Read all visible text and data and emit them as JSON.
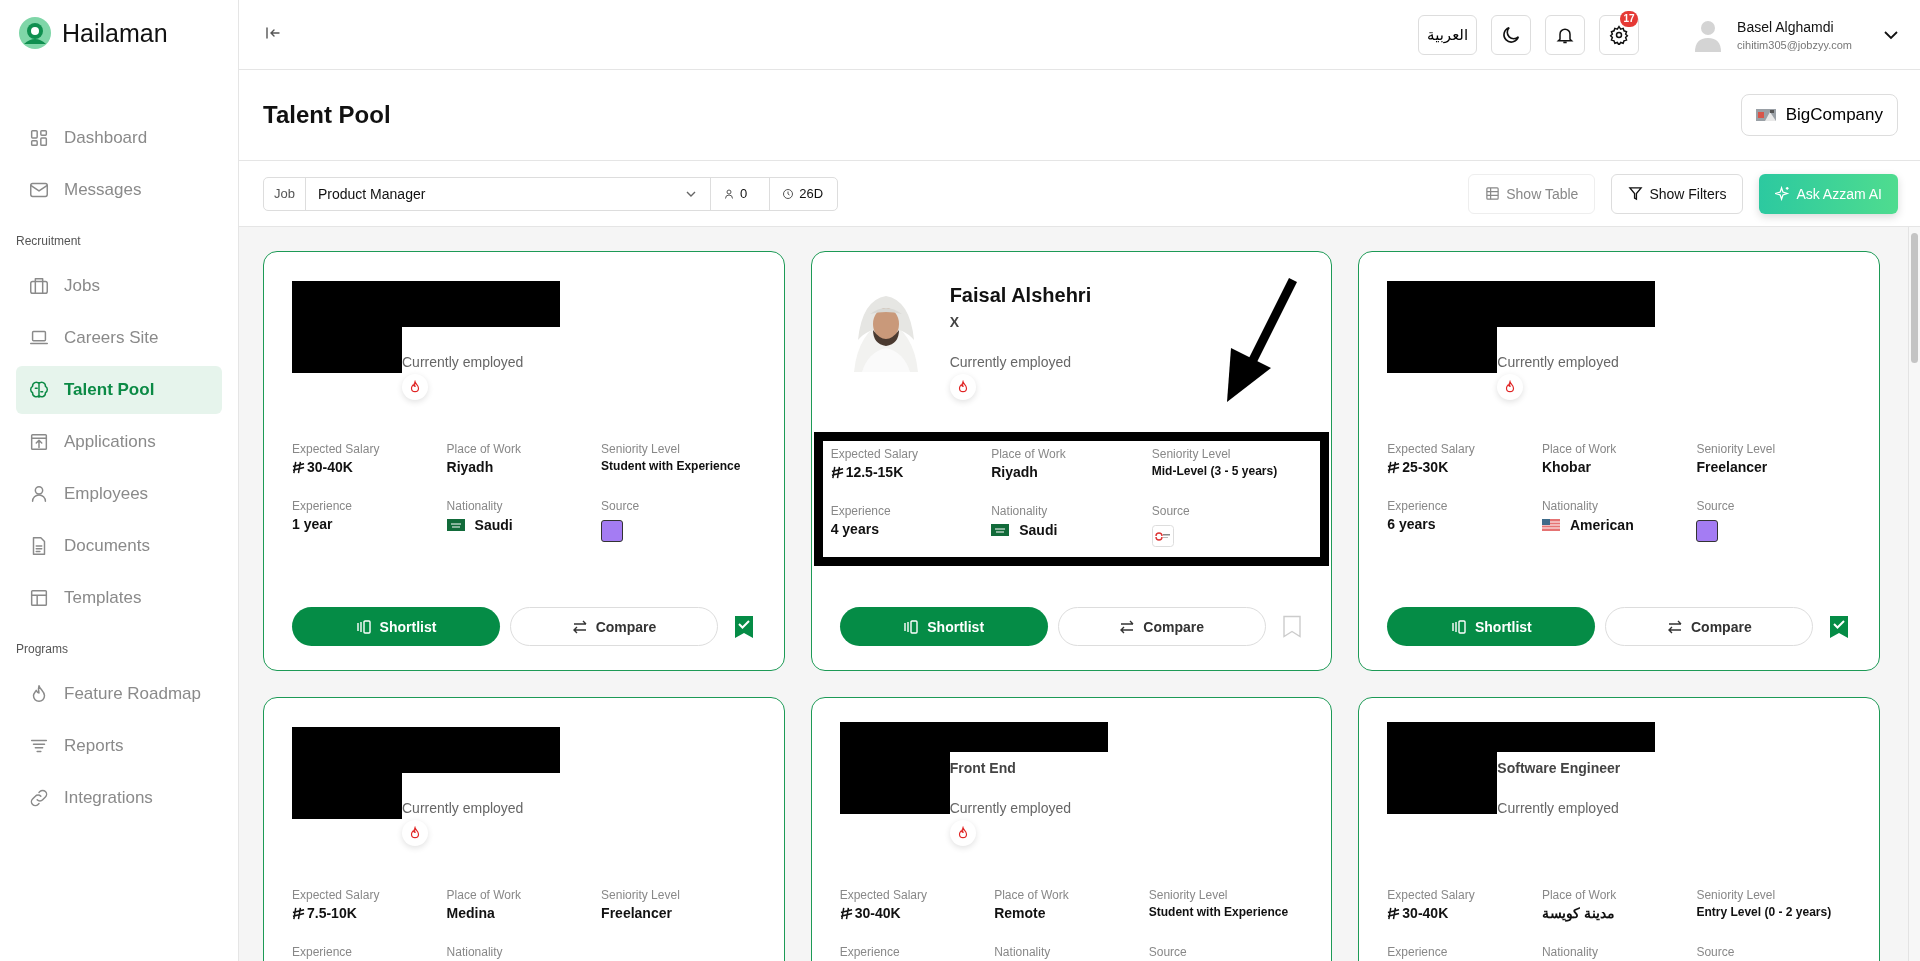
{
  "app": {
    "name": "Hailaman"
  },
  "sidebar": {
    "groups": [
      {
        "items": [
          {
            "label": "Dashboard",
            "selected": false
          },
          {
            "label": "Messages",
            "selected": false
          }
        ]
      },
      {
        "heading": "Recruitment",
        "items": [
          {
            "label": "Jobs",
            "selected": false
          },
          {
            "label": "Careers Site",
            "selected": false
          },
          {
            "label": "Talent Pool",
            "selected": true
          },
          {
            "label": "Applications",
            "selected": false
          },
          {
            "label": "Employees",
            "selected": false
          },
          {
            "label": "Documents",
            "selected": false
          },
          {
            "label": "Templates",
            "selected": false
          }
        ]
      },
      {
        "heading": "Programs",
        "items": [
          {
            "label": "Feature Roadmap",
            "selected": false
          },
          {
            "label": "Reports",
            "selected": false
          },
          {
            "label": "Integrations",
            "selected": false
          }
        ]
      }
    ]
  },
  "topbar": {
    "language": "العربية",
    "notifications": "17",
    "user": {
      "name": "Basel Alghamdi",
      "email": "cihitim305@jobzyy.com"
    }
  },
  "page": {
    "title": "Talent Pool",
    "company": "BigCompany"
  },
  "filter_bar": {
    "job_label": "Job",
    "job": "Product Manager",
    "applicants": "0",
    "age": "26D",
    "buttons": [
      {
        "label": "Show Table",
        "kind": "table",
        "disabled": true
      },
      {
        "label": "Show Filters",
        "kind": "filter",
        "disabled": false
      },
      {
        "label": "Ask Azzam AI",
        "kind": "ai",
        "disabled": false
      }
    ]
  },
  "cards": [
    {
      "redacted": true,
      "photo": false,
      "status": "Currently employed",
      "hot": true,
      "annotated": false,
      "bookmarked": true,
      "facts": [
        {
          "kind": "salary",
          "label": "Expected Salary",
          "value": "30-40K"
        },
        {
          "kind": "text",
          "label": "Place of Work",
          "value": "Riyadh"
        },
        {
          "kind": "small",
          "label": "Seniority Level",
          "value": "Student with Experience"
        },
        {
          "kind": "text",
          "label": "Experience",
          "value": "1 year"
        },
        {
          "kind": "greenflag",
          "label": "Nationality",
          "value": "Saudi"
        },
        {
          "kind": "source-square",
          "label": "Source"
        }
      ],
      "shortlist": "Shortlist",
      "compare": "Compare"
    },
    {
      "redacted": false,
      "photo": true,
      "name": "Faisal Alshehri",
      "subtitle": "X",
      "status": "Currently employed",
      "hot": true,
      "annotated": true,
      "bookmarked": false,
      "facts": [
        {
          "kind": "salary",
          "label": "Expected Salary",
          "value": "12.5-15K"
        },
        {
          "kind": "text",
          "label": "Place of Work",
          "value": "Riyadh"
        },
        {
          "kind": "small",
          "label": "Seniority Level",
          "value": "Mid-Level (3 - 5 years)"
        },
        {
          "kind": "text",
          "label": "Experience",
          "value": "4 years"
        },
        {
          "kind": "greenflag",
          "label": "Nationality",
          "value": "Saudi"
        },
        {
          "kind": "source-logo",
          "label": "Source"
        }
      ],
      "shortlist": "Shortlist",
      "compare": "Compare"
    },
    {
      "redacted": true,
      "photo": false,
      "status": "Currently employed",
      "hot": true,
      "annotated": false,
      "bookmarked": true,
      "facts": [
        {
          "kind": "salary",
          "label": "Expected Salary",
          "value": "25-30K"
        },
        {
          "kind": "text",
          "label": "Place of Work",
          "value": "Khobar"
        },
        {
          "kind": "text",
          "label": "Seniority Level",
          "value": "Freelancer"
        },
        {
          "kind": "text",
          "label": "Experience",
          "value": "6 years"
        },
        {
          "kind": "stripeflag",
          "label": "Nationality",
          "value": "American"
        },
        {
          "kind": "source-square",
          "label": "Source"
        }
      ],
      "shortlist": "Shortlist",
      "compare": "Compare"
    },
    {
      "redacted": true,
      "photo": false,
      "status": "Currently employed",
      "hot": true,
      "annotated": false,
      "facts": [
        {
          "kind": "salary",
          "label": "Expected Salary",
          "value": "7.5-10K"
        },
        {
          "kind": "text",
          "label": "Place of Work",
          "value": "Medina"
        },
        {
          "kind": "text",
          "label": "Seniority Level",
          "value": "Freelancer"
        },
        {
          "kind": "label",
          "label": "Experience"
        },
        {
          "kind": "label",
          "label": "Nationality"
        }
      ]
    },
    {
      "redacted": true,
      "photo": false,
      "subtitle": "Front End",
      "status": "Currently employed",
      "hot": true,
      "annotated": false,
      "facts": [
        {
          "kind": "salary",
          "label": "Expected Salary",
          "value": "30-40K"
        },
        {
          "kind": "text",
          "label": "Place of Work",
          "value": "Remote"
        },
        {
          "kind": "small",
          "label": "Seniority Level",
          "value": "Student with Experience"
        },
        {
          "kind": "label",
          "label": "Experience"
        },
        {
          "kind": "label",
          "label": "Nationality"
        },
        {
          "kind": "label",
          "label": "Source"
        }
      ]
    },
    {
      "redacted": true,
      "photo": false,
      "subtitle": "Software Engineer",
      "status": "Currently employed",
      "hot": false,
      "annotated": false,
      "facts": [
        {
          "kind": "salary",
          "label": "Expected Salary",
          "value": "30-40K"
        },
        {
          "kind": "text",
          "label": "Place of Work",
          "value": "مدينة كويسة"
        },
        {
          "kind": "small",
          "label": "Seniority Level",
          "value": "Entry Level (0 - 2 years)"
        },
        {
          "kind": "label",
          "label": "Experience"
        },
        {
          "kind": "label",
          "label": "Nationality"
        },
        {
          "kind": "label",
          "label": "Source"
        }
      ]
    }
  ]
}
